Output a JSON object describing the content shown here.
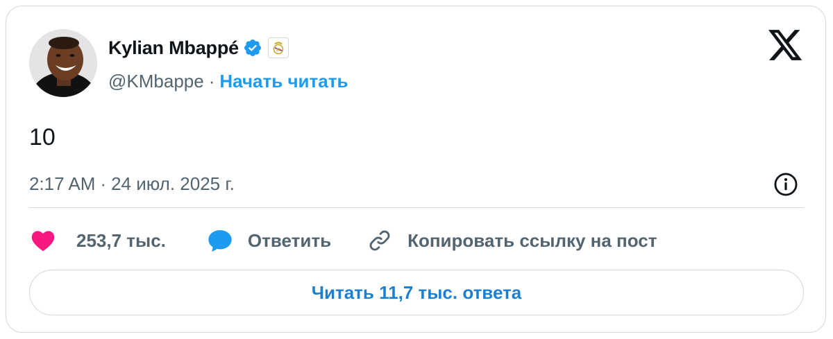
{
  "author": {
    "name": "Kylian Mbappé",
    "handle": "@KMbappe",
    "separator": "·",
    "follow_label": "Начать читать"
  },
  "tweet": {
    "text": "10",
    "time": "2:17 AM",
    "date": "24 июл. 2025 г.",
    "separator": "·"
  },
  "actions": {
    "likes_count": "253,7 тыс.",
    "reply_label": "Ответить",
    "copy_link_label": "Копировать ссылку на пост"
  },
  "read_replies_label": "Читать 11,7 тыс. ответа",
  "icons": {
    "avatar": "profile-photo",
    "verified": "verified-badge-icon",
    "affiliate": "real-madrid-crest-icon",
    "brand": "x-logo-icon",
    "info": "info-icon",
    "like": "heart-icon",
    "reply": "speech-bubble-icon",
    "copy": "link-icon"
  },
  "colors": {
    "accent": "#1d9bf0",
    "like": "#f91880",
    "text": "#0f1419",
    "muted": "#536471",
    "border": "#cfd9de"
  }
}
